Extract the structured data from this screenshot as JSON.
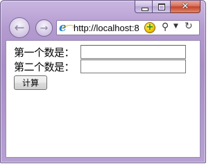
{
  "window": {
    "caption_buttons": {
      "minimize_icon": "minimize-icon",
      "maximize_icon": "maximize-icon",
      "close_glyph": "✕"
    }
  },
  "toolbar": {
    "back_glyph": "←",
    "forward_glyph": "→",
    "address": {
      "url": "http://localhost:8",
      "compat_glyph": "+",
      "search_glyph": "⚲",
      "dropdown_glyph": "▼",
      "refresh_glyph": "↻"
    }
  },
  "form": {
    "first_label": "第一个数是：",
    "first_value": "",
    "second_label": "第二个数是：",
    "second_value": "",
    "calc_button": "计算"
  },
  "colors": {
    "frame": "#b39acf",
    "close_button": "#c4432c"
  }
}
